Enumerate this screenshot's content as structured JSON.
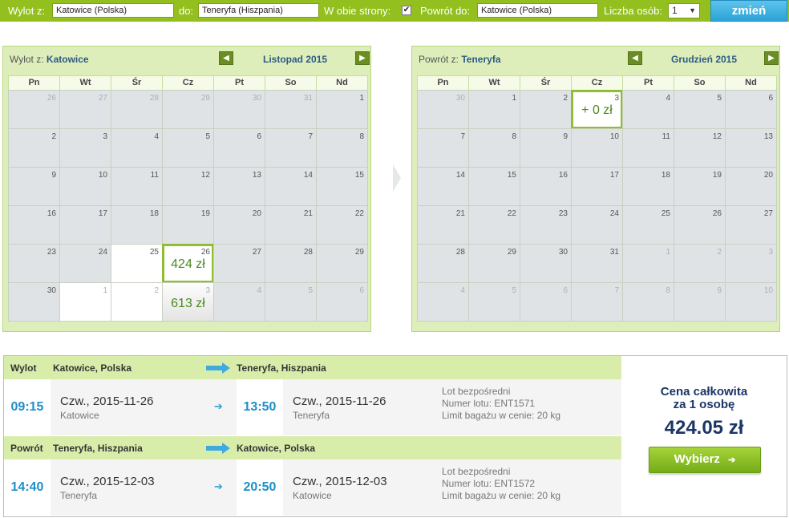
{
  "search": {
    "from_label": "Wylot z:",
    "from_value": "Katowice (Polska)",
    "to_label": "do:",
    "to_value": "Teneryfa (Hiszpania)",
    "round_trip_label": "W obie strony:",
    "round_trip_checked": "✔",
    "return_label": "Powrót do:",
    "return_value": "Katowice (Polska)",
    "persons_label": "Liczba osób:",
    "persons_value": "1",
    "change_button": "zmień"
  },
  "calendars": [
    {
      "title_prefix": "Wylot z:",
      "title_city": "Katowice",
      "month": "Listopad 2015",
      "weekdays": [
        "Pn",
        "Wt",
        "Śr",
        "Cz",
        "Pt",
        "So",
        "Nd"
      ],
      "weeks": [
        [
          {
            "n": "26",
            "m": true
          },
          {
            "n": "27",
            "m": true
          },
          {
            "n": "28",
            "m": true
          },
          {
            "n": "29",
            "m": true
          },
          {
            "n": "30",
            "m": true
          },
          {
            "n": "31",
            "m": true
          },
          {
            "n": "1"
          }
        ],
        [
          {
            "n": "2"
          },
          {
            "n": "3"
          },
          {
            "n": "4"
          },
          {
            "n": "5"
          },
          {
            "n": "6"
          },
          {
            "n": "7"
          },
          {
            "n": "8"
          }
        ],
        [
          {
            "n": "9"
          },
          {
            "n": "10"
          },
          {
            "n": "11"
          },
          {
            "n": "12"
          },
          {
            "n": "13"
          },
          {
            "n": "14"
          },
          {
            "n": "15"
          }
        ],
        [
          {
            "n": "16"
          },
          {
            "n": "17"
          },
          {
            "n": "18"
          },
          {
            "n": "19"
          },
          {
            "n": "20"
          },
          {
            "n": "21"
          },
          {
            "n": "22"
          }
        ],
        [
          {
            "n": "23"
          },
          {
            "n": "24"
          },
          {
            "n": "25",
            "white": true
          },
          {
            "n": "26",
            "price": "424 zł",
            "selected": true
          },
          {
            "n": "27"
          },
          {
            "n": "28"
          },
          {
            "n": "29"
          }
        ],
        [
          {
            "n": "30"
          },
          {
            "n": "1",
            "m": true,
            "white": true
          },
          {
            "n": "2",
            "m": true,
            "white": true
          },
          {
            "n": "3",
            "m": true,
            "price": "613 zł"
          },
          {
            "n": "4",
            "m": true
          },
          {
            "n": "5",
            "m": true
          },
          {
            "n": "6",
            "m": true
          }
        ]
      ]
    },
    {
      "title_prefix": "Powrót z:",
      "title_city": "Teneryfa",
      "month": "Grudzień 2015",
      "weekdays": [
        "Pn",
        "Wt",
        "Śr",
        "Cz",
        "Pt",
        "So",
        "Nd"
      ],
      "weeks": [
        [
          {
            "n": "30",
            "m": true
          },
          {
            "n": "1"
          },
          {
            "n": "2"
          },
          {
            "n": "3",
            "price": "+ 0 zł",
            "selected": true
          },
          {
            "n": "4"
          },
          {
            "n": "5"
          },
          {
            "n": "6"
          }
        ],
        [
          {
            "n": "7"
          },
          {
            "n": "8"
          },
          {
            "n": "9"
          },
          {
            "n": "10"
          },
          {
            "n": "11"
          },
          {
            "n": "12"
          },
          {
            "n": "13"
          }
        ],
        [
          {
            "n": "14"
          },
          {
            "n": "15"
          },
          {
            "n": "16"
          },
          {
            "n": "17"
          },
          {
            "n": "18"
          },
          {
            "n": "19"
          },
          {
            "n": "20"
          }
        ],
        [
          {
            "n": "21"
          },
          {
            "n": "22"
          },
          {
            "n": "23"
          },
          {
            "n": "24"
          },
          {
            "n": "25"
          },
          {
            "n": "26"
          },
          {
            "n": "27"
          }
        ],
        [
          {
            "n": "28"
          },
          {
            "n": "29"
          },
          {
            "n": "30"
          },
          {
            "n": "31"
          },
          {
            "n": "1",
            "m": true
          },
          {
            "n": "2",
            "m": true
          },
          {
            "n": "3",
            "m": true
          }
        ],
        [
          {
            "n": "4",
            "m": true
          },
          {
            "n": "5",
            "m": true
          },
          {
            "n": "6",
            "m": true
          },
          {
            "n": "7",
            "m": true
          },
          {
            "n": "8",
            "m": true
          },
          {
            "n": "9",
            "m": true
          },
          {
            "n": "10",
            "m": true
          }
        ]
      ]
    }
  ],
  "outbound": {
    "label": "Wylot",
    "from": "Katowice, Polska",
    "to": "Teneryfa, Hiszpania",
    "dep_time": "09:15",
    "dep_date": "Czw., 2015-11-26",
    "dep_city": "Katowice",
    "arr_time": "13:50",
    "arr_date": "Czw., 2015-11-26",
    "arr_city": "Teneryfa",
    "info_1": "Lot bezpośredni",
    "info_2": "Numer lotu: ENT1571",
    "info_3": "Limit bagażu w cenie: 20 kg"
  },
  "return": {
    "label": "Powrót",
    "from": "Teneryfa, Hiszpania",
    "to": "Katowice, Polska",
    "dep_time": "14:40",
    "dep_date": "Czw., 2015-12-03",
    "dep_city": "Teneryfa",
    "arr_time": "20:50",
    "arr_date": "Czw., 2015-12-03",
    "arr_city": "Katowice",
    "info_1": "Lot bezpośredni",
    "info_2": "Numer lotu: ENT1572",
    "info_3": "Limit bagażu w cenie: 20 kg"
  },
  "price": {
    "label_1": "Cena całkowita",
    "label_2": "za 1 osobę",
    "total": "424.05 zł",
    "select_button": "Wybierz"
  },
  "icons": {
    "prev": "arrow-left-icon",
    "next": "arrow-right-icon",
    "route": "route-arrow-icon",
    "dropdown": "chevron-down-icon"
  },
  "colors": {
    "topbar": "#93c01f",
    "accent_blue": "#2aa3d6",
    "time_blue": "#1e8fc8",
    "price_green": "#4a8a1c",
    "navy": "#1b3566"
  }
}
